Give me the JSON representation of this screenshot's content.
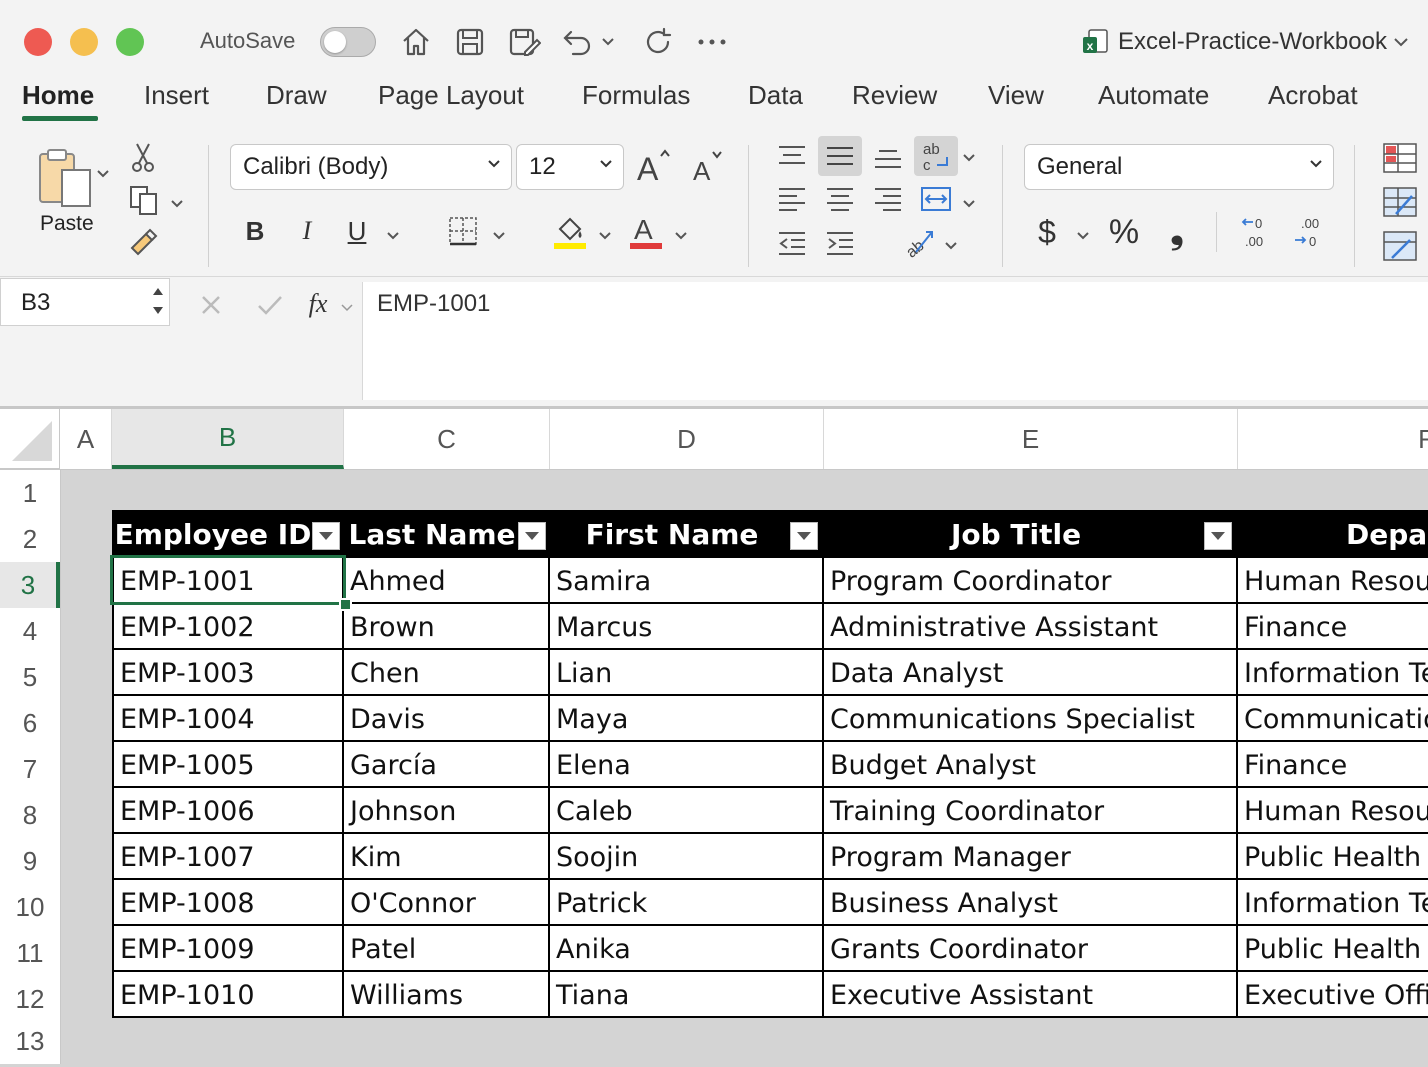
{
  "titlebar": {
    "autosave_label": "AutoSave",
    "autosave_state": "off",
    "doc_title": "Excel-Practice-Workbook",
    "icons": [
      "home-icon",
      "save-icon",
      "save-as-icon",
      "undo-icon",
      "redo-icon",
      "more-icon"
    ]
  },
  "tabs": [
    "Home",
    "Insert",
    "Draw",
    "Page Layout",
    "Formulas",
    "Data",
    "Review",
    "View",
    "Automate",
    "Acrobat"
  ],
  "active_tab": "Home",
  "ribbon": {
    "paste_label": "Paste",
    "font_name": "Calibri (Body)",
    "font_size": "12",
    "bold": "B",
    "italic": "I",
    "underline": "U",
    "number_format": "General",
    "currency": "$",
    "percent": "%",
    "comma": "❟"
  },
  "formula_bar": {
    "name_box": "B3",
    "fx": "fx",
    "value": "EMP-1001"
  },
  "columns": [
    "A",
    "B",
    "C",
    "D",
    "E",
    "F"
  ],
  "selected_column": "B",
  "rows": [
    "1",
    "2",
    "3",
    "4",
    "5",
    "6",
    "7",
    "8",
    "9",
    "10",
    "11",
    "12",
    "13"
  ],
  "selected_row": "3",
  "table": {
    "headers": [
      "Employee ID",
      "Last Name",
      "First Name",
      "Job Title",
      "Depar"
    ],
    "rows": [
      [
        "EMP-1001",
        "Ahmed",
        "Samira",
        "Program Coordinator",
        "Human Resou"
      ],
      [
        "EMP-1002",
        "Brown",
        "Marcus",
        "Administrative Assistant",
        "Finance"
      ],
      [
        "EMP-1003",
        "Chen",
        "Lian",
        "Data Analyst",
        "Information Te"
      ],
      [
        "EMP-1004",
        "Davis",
        "Maya",
        "Communications Specialist",
        "Communicatio"
      ],
      [
        "EMP-1005",
        "García",
        "Elena",
        "Budget Analyst",
        "Finance"
      ],
      [
        "EMP-1006",
        "Johnson",
        "Caleb",
        "Training Coordinator",
        "Human Resou"
      ],
      [
        "EMP-1007",
        "Kim",
        "Soojin",
        "Program Manager",
        "Public Health"
      ],
      [
        "EMP-1008",
        "O'Connor",
        "Patrick",
        "Business Analyst",
        "Information Te"
      ],
      [
        "EMP-1009",
        "Patel",
        "Anika",
        "Grants Coordinator",
        "Public Health"
      ],
      [
        "EMP-1010",
        "Williams",
        "Tiana",
        "Executive Assistant",
        "Executive Offic"
      ]
    ]
  },
  "colors": {
    "accent": "#217346",
    "header_bg": "#000000",
    "close": "#ee5a52",
    "minimize": "#f5bf4f",
    "maximize": "#61c554",
    "highlight": "#ffeb00",
    "font_color": "#e03a3a"
  }
}
